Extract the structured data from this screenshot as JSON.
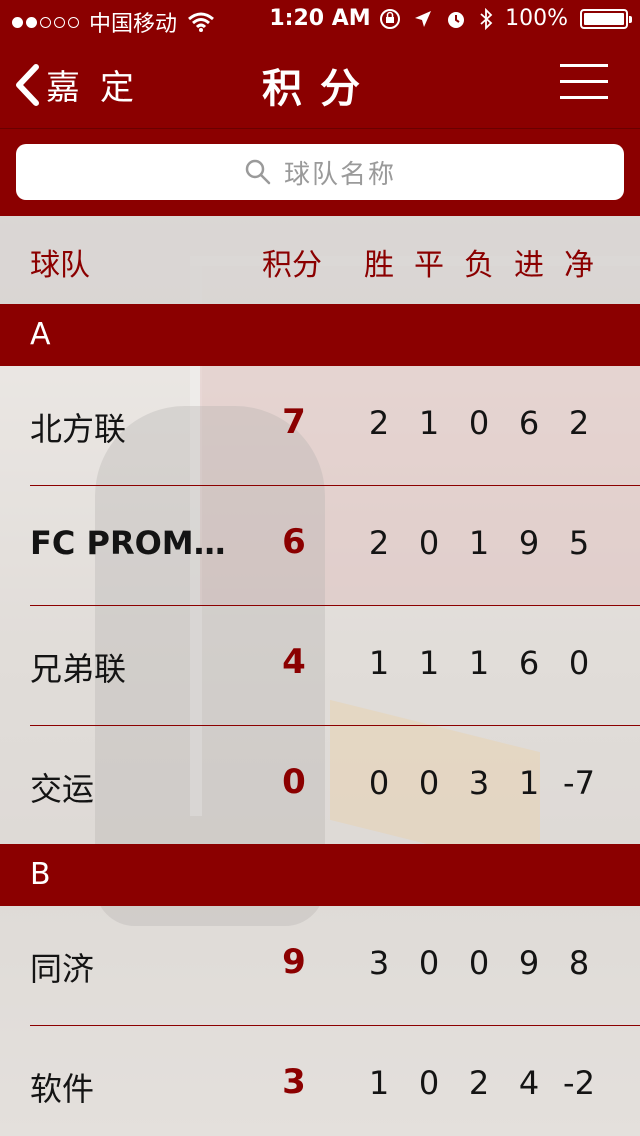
{
  "status_bar": {
    "carrier": "中国移动",
    "time": "1:20 AM",
    "battery": "100%"
  },
  "nav": {
    "back_label": "嘉定",
    "title": "积分"
  },
  "search": {
    "placeholder": "球队名称"
  },
  "table_header": {
    "team": "球队",
    "points": "积分",
    "won": "胜",
    "drawn": "平",
    "lost": "负",
    "goals_for": "进",
    "goal_diff": "净"
  },
  "groups": [
    {
      "name": "A",
      "rows": [
        {
          "team": "北方联",
          "points": "7",
          "won": "2",
          "drawn": "1",
          "lost": "0",
          "goals_for": "6",
          "goal_diff": "2"
        },
        {
          "team": "FC PROM…",
          "points": "6",
          "won": "2",
          "drawn": "0",
          "lost": "1",
          "goals_for": "9",
          "goal_diff": "5"
        },
        {
          "team": "兄弟联",
          "points": "4",
          "won": "1",
          "drawn": "1",
          "lost": "1",
          "goals_for": "6",
          "goal_diff": "0"
        },
        {
          "team": "交运",
          "points": "0",
          "won": "0",
          "drawn": "0",
          "lost": "3",
          "goals_for": "1",
          "goal_diff": "-7"
        }
      ]
    },
    {
      "name": "B",
      "rows": [
        {
          "team": "同济",
          "points": "9",
          "won": "3",
          "drawn": "0",
          "lost": "0",
          "goals_for": "9",
          "goal_diff": "8"
        },
        {
          "team": "软件",
          "points": "3",
          "won": "1",
          "drawn": "0",
          "lost": "2",
          "goals_for": "4",
          "goal_diff": "-2"
        }
      ]
    }
  ],
  "colors": {
    "primary": "#8b0000",
    "text": "#141414",
    "placeholder": "#9a9a9a"
  }
}
